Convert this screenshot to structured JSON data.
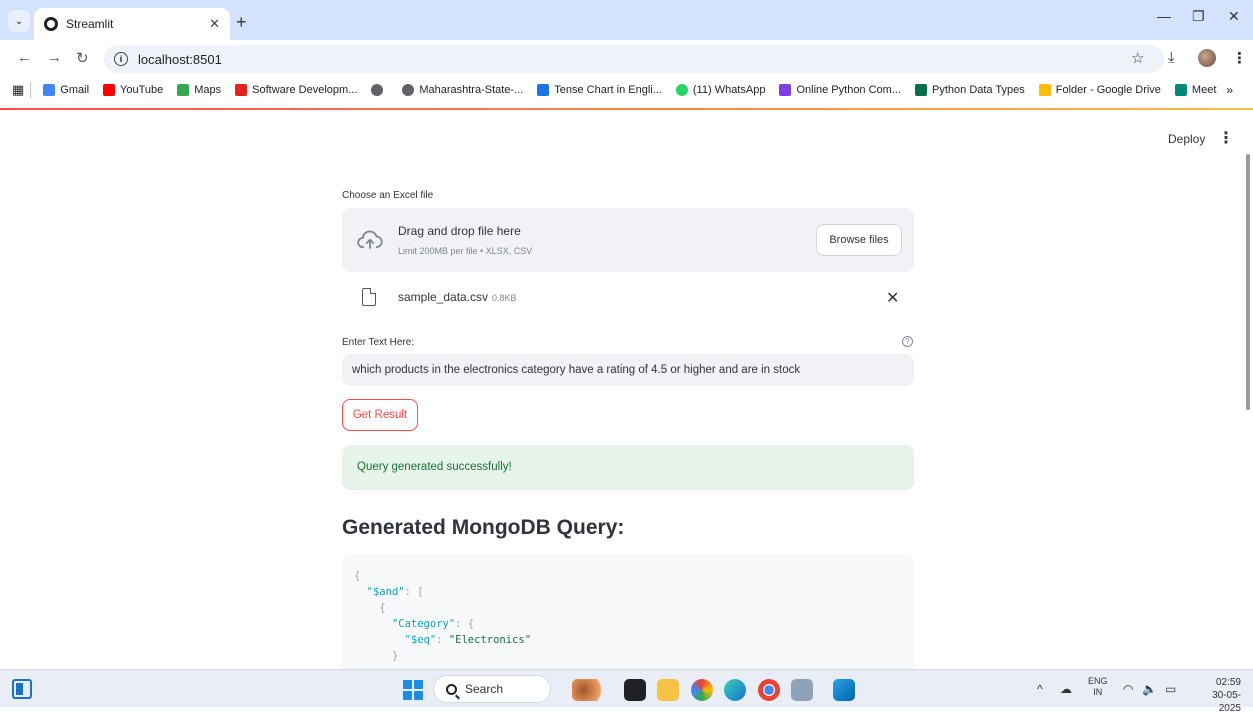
{
  "browser": {
    "tab_title": "Streamlit",
    "url": "localhost:8501",
    "bookmarks": [
      {
        "label": "Gmail",
        "color": "#ea4335"
      },
      {
        "label": "YouTube",
        "color": "#ff0000"
      },
      {
        "label": "Maps",
        "color": "#34a853"
      },
      {
        "label": "Software Developm...",
        "color": "#e8211a"
      },
      {
        "label": "",
        "color": "#5f6368"
      },
      {
        "label": "Maharashtra-State-...",
        "color": "#5f6368"
      },
      {
        "label": "Tense Chart in Engli...",
        "color": "#1a73e8"
      },
      {
        "label": "(11) WhatsApp",
        "color": "#25d366"
      },
      {
        "label": "Online Python Com...",
        "color": "#7b3fe4"
      },
      {
        "label": "Python Data Types",
        "color": "#0b6e4f"
      },
      {
        "label": "Folder - Google Drive",
        "color": "#fbbc04"
      },
      {
        "label": "Meet",
        "color": "#00897b"
      }
    ]
  },
  "app": {
    "deploy_label": "Deploy",
    "uploader": {
      "label": "Choose an Excel file",
      "title": "Drag and drop file here",
      "subtitle": "Limit 200MB per file • XLSX, CSV",
      "browse_label": "Browse files"
    },
    "file": {
      "name": "sample_data.csv",
      "size": "0.8KB"
    },
    "text_input": {
      "label": "Enter Text Here:",
      "value": "which products in the electronics category have a rating of 4.5 or higher and are in stock"
    },
    "button_label": "Get Result",
    "success_message": "Query generated successfully!",
    "heading": "Generated MongoDB Query:",
    "code_lines": [
      {
        "indent": "",
        "key": "",
        "text": "{"
      },
      {
        "indent": "  ",
        "key": "\"$and\"",
        "text": ": ["
      },
      {
        "indent": "    ",
        "key": "",
        "text": "{"
      },
      {
        "indent": "      ",
        "key": "\"Category\"",
        "text": ": {"
      },
      {
        "indent": "        ",
        "key": "\"$eq\"",
        "text": ": ",
        "value": "\"Electronics\""
      },
      {
        "indent": "      ",
        "key": "",
        "text": "}"
      }
    ]
  },
  "taskbar": {
    "search_label": "Search",
    "lang_top": "ENG",
    "lang_bottom": "IN",
    "time": "02:59",
    "date": "30-05-2025"
  }
}
